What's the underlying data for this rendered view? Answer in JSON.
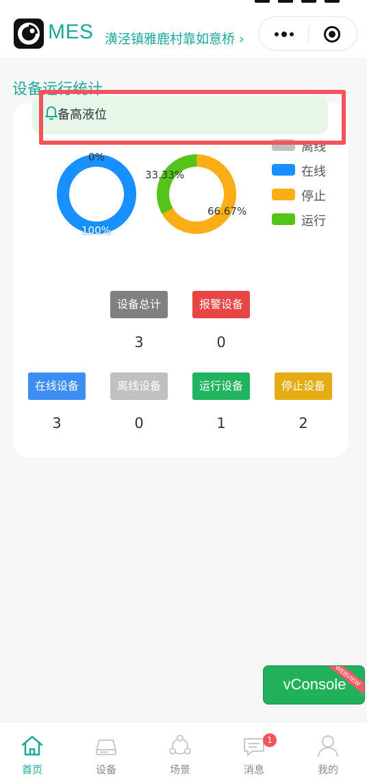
{
  "header": {
    "app_name": "MES",
    "location": "潢泾镇雅鹿村靠如意桥 ›"
  },
  "section": {
    "title": "设备运行统计"
  },
  "notice": {
    "text": "备高液位"
  },
  "donut_online": {
    "zero_label": "0%",
    "full_label": "100%",
    "online_fraction": 1.0
  },
  "donut_run": {
    "run_label": "33.33%",
    "stop_label": "66.67%",
    "run_fraction": 0.3333,
    "stop_fraction": 0.6667
  },
  "legend": [
    {
      "label": "离线",
      "color": "#c0c0c0"
    },
    {
      "label": "在线",
      "color": "#1890ff"
    },
    {
      "label": "停止",
      "color": "#faad14"
    },
    {
      "label": "运行",
      "color": "#52c41a"
    }
  ],
  "stats": {
    "total": {
      "label": "设备总计",
      "value": "3",
      "color": "#808080"
    },
    "alarm": {
      "label": "报警设备",
      "value": "0",
      "color": "#e84545"
    },
    "online": {
      "label": "在线设备",
      "value": "3",
      "color": "#3d8ef2"
    },
    "offline": {
      "label": "离线设备",
      "value": "0",
      "color": "#c0c0c0"
    },
    "running": {
      "label": "运行设备",
      "value": "1",
      "color": "#22b35f"
    },
    "stopped": {
      "label": "停止设备",
      "value": "2",
      "color": "#e5ac14"
    }
  },
  "vconsole": {
    "label": "vConsole",
    "tag": "WEBVIEW"
  },
  "tabbar": {
    "items": [
      {
        "label": "首页",
        "icon": "home-icon"
      },
      {
        "label": "设备",
        "icon": "device-icon"
      },
      {
        "label": "场景",
        "icon": "scene-icon"
      },
      {
        "label": "消息",
        "icon": "message-icon",
        "badge": "1"
      },
      {
        "label": "我的",
        "icon": "user-icon"
      }
    ]
  },
  "colors": {
    "accent": "#1aa89a",
    "online": "#1890ff",
    "stop": "#faad14",
    "run": "#52c41a",
    "offline": "#c0c0c0"
  }
}
